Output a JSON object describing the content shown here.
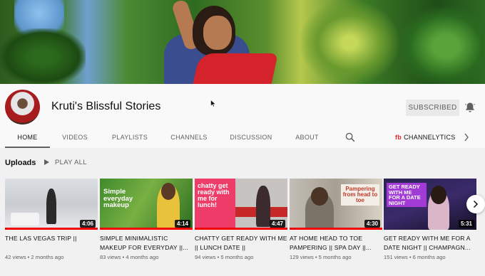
{
  "channel": {
    "name": "Kruti's Blissful Stories",
    "subscribe_label": "SUBSCRIBED"
  },
  "tabs": [
    {
      "label": "HOME",
      "active": true
    },
    {
      "label": "VIDEOS",
      "active": false
    },
    {
      "label": "PLAYLISTS",
      "active": false
    },
    {
      "label": "CHANNELS",
      "active": false
    },
    {
      "label": "DISCUSSION",
      "active": false
    },
    {
      "label": "ABOUT",
      "active": false
    }
  ],
  "extension": {
    "badge": "fb",
    "label": "CHANNELYTICS"
  },
  "uploads": {
    "title": "Uploads",
    "play_all": "PLAY ALL",
    "videos": [
      {
        "title": "THE LAS VEGAS TRIP ||",
        "meta": "42 views • 2 months ago",
        "duration": "4:06",
        "overlay": "",
        "watched_fraction": 1.0
      },
      {
        "title": "SIMPLE MINIMALISTIC MAKEUP FOR EVERYDAY ||...",
        "meta": "83 views • 4 months ago",
        "duration": "4:14",
        "overlay": "Simple everyday makeup",
        "watched_fraction": 1.0
      },
      {
        "title": "CHATTY GET READY WITH ME || LUNCH DATE ||",
        "meta": "94 views • 5 months ago",
        "duration": "4:47",
        "overlay": "chatty get ready with me for lunch!",
        "watched_fraction": 1.0
      },
      {
        "title": "AT HOME HEAD TO TOE PAMPERING || SPA DAY ||...",
        "meta": "129 views • 5 months ago",
        "duration": "4:30",
        "overlay": "Pampering from head to toe",
        "watched_fraction": 1.0
      },
      {
        "title": "GET READY WITH ME FOR A DATE NIGHT || CHAMPAGN...",
        "meta": "151 views • 6 months ago",
        "duration": "5:31",
        "overlay": "GET READY WITH ME FOR A DATE NIGHT",
        "watched_fraction": 0.0
      }
    ]
  },
  "colors": {
    "accent_red": "#e00000",
    "text_primary": "#0f0f0f",
    "text_secondary": "#606060",
    "channelytics_red": "#e8262b"
  }
}
